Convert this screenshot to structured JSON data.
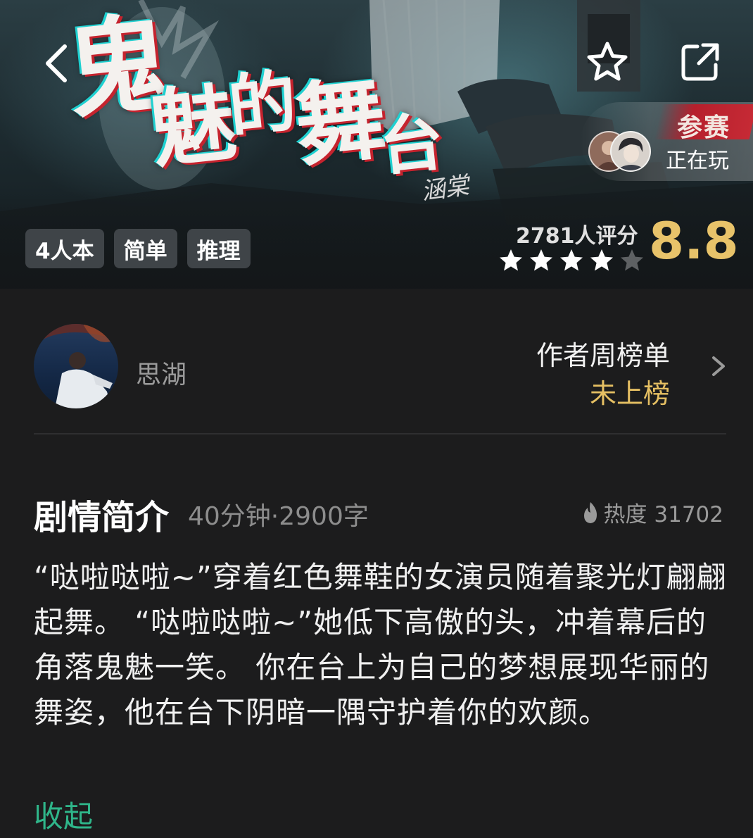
{
  "hero": {
    "title_chars": [
      "鬼",
      "魅",
      "的",
      "舞",
      "台"
    ],
    "signature": "涵棠",
    "tags": [
      "4人本",
      "简单",
      "推理"
    ],
    "contest_label": "参赛",
    "playing_label": "正在玩",
    "rating_count": "2781人评分",
    "rating_score": "8.8",
    "rating_stars": 4,
    "icons": {
      "back": "back-chevron-icon",
      "favorite": "star-outline-icon",
      "share": "share-external-icon"
    },
    "colors": {
      "score": "#e8c36a",
      "title_shadow_red": "#c5232e",
      "title_shadow_cyan": "#1fd0d0"
    }
  },
  "author": {
    "name": "思湖",
    "rank_title": "作者周榜单",
    "rank_status": "未上榜"
  },
  "synopsis": {
    "title": "剧情简介",
    "meta": "40分钟·2900字",
    "heat_label": "热度 31702",
    "text": "“哒啦哒啦~”穿着红色舞鞋的女演员随着聚光灯翩翩起舞。 “哒啦哒啦~”她低下高傲的头，冲着幕后的角落鬼魅一笑。 你在台上为自己的梦想展现华丽的舞姿，他在台下阴暗一隅守护着你的欢颜。",
    "collapse_label": "收起",
    "colors": {
      "collapse": "#2fb68a",
      "rank_status": "#e6c063"
    }
  }
}
